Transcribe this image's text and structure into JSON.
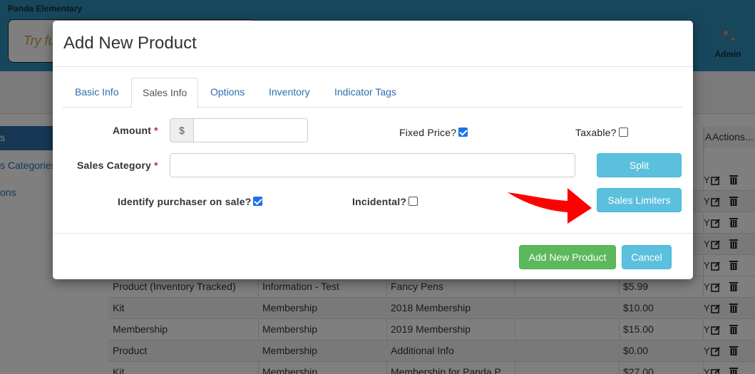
{
  "app": {
    "org_name": "Panda Elementary",
    "search_placeholder": "Try fu",
    "admin_label": "Admin",
    "gear_icon": "gear-icon"
  },
  "sidebar": {
    "items": [
      {
        "label": "s",
        "active": true
      },
      {
        "label": "s Categories",
        "active": false
      },
      {
        "label": "ons",
        "active": false
      }
    ]
  },
  "grid": {
    "headers": [
      "A",
      "Actions..."
    ],
    "rows": [
      {
        "type": "Product (Inventory Tracked)",
        "category": "Information - Test",
        "name": "Fancy Pens",
        "price": "$5.99",
        "flag": "Y"
      },
      {
        "type": "Kit",
        "category": "Membership",
        "name": "2018 Membership",
        "price": "$10.00",
        "flag": "Y"
      },
      {
        "type": "Membership",
        "category": "Membership",
        "name": "2019 Membership",
        "price": "$15.00",
        "flag": "Y"
      },
      {
        "type": "Product",
        "category": "Membership",
        "name": "Additional Info",
        "price": "$0.00",
        "flag": "Y"
      },
      {
        "type": "Kit",
        "category": "Membership",
        "name": "Membership for Panda P...",
        "price": "$27.00",
        "flag": "Y"
      }
    ]
  },
  "modal": {
    "title": "Add New Product",
    "tabs": [
      {
        "label": "Basic Info",
        "active": false
      },
      {
        "label": "Sales Info",
        "active": true
      },
      {
        "label": "Options",
        "active": false
      },
      {
        "label": "Inventory",
        "active": false
      },
      {
        "label": "Indicator Tags",
        "active": false
      }
    ],
    "form": {
      "amount_label": "Amount",
      "amount_prefix": "$",
      "amount_value": "",
      "fixed_price_label": "Fixed Price?",
      "fixed_price_checked": true,
      "taxable_label": "Taxable?",
      "taxable_checked": false,
      "sales_category_label": "Sales Category",
      "sales_category_value": "",
      "split_button": "Split",
      "identify_purchaser_label": "Identify purchaser on sale?",
      "identify_purchaser_checked": true,
      "incidental_label": "Incidental?",
      "incidental_checked": false,
      "sales_limiters_button": "Sales Limiters",
      "required_marker": "*"
    },
    "footer": {
      "add_button": "Add New Product",
      "cancel_button": "Cancel"
    }
  },
  "annotation": {
    "arrow_color": "#ff0000"
  },
  "colors": {
    "info": "#5bc0de",
    "success": "#5cb85c",
    "link": "#2a6fb0",
    "header": "#2f8fbb"
  }
}
